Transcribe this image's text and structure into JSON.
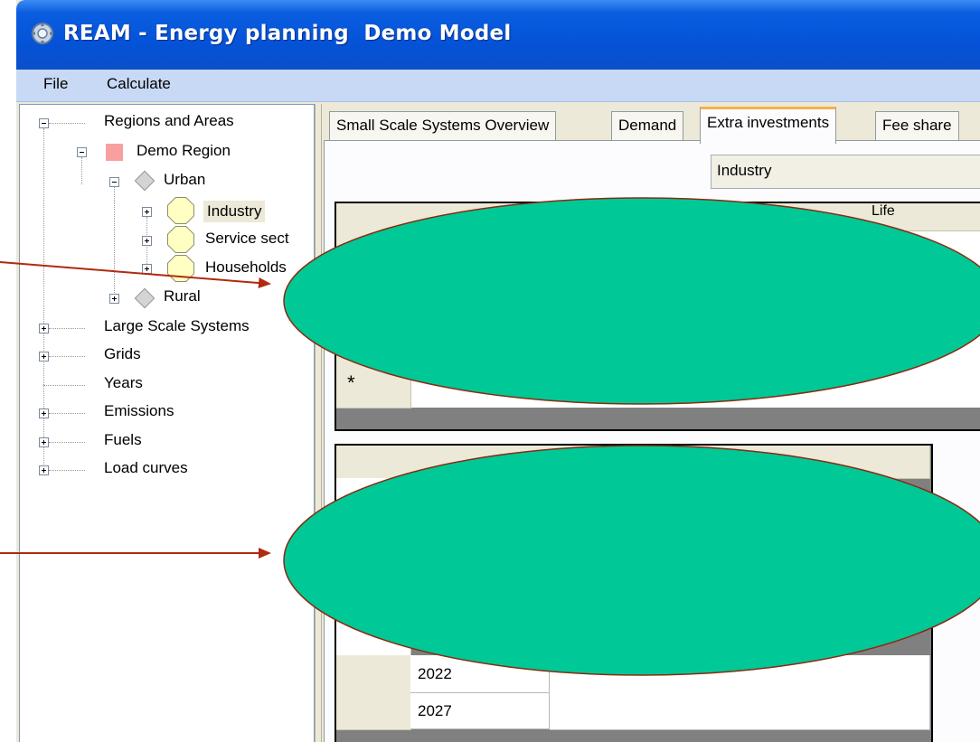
{
  "window": {
    "title": "REAM - Energy planning  Demo Model",
    "accent_color": "#0553d8"
  },
  "menu": {
    "items": [
      "File",
      "Calculate"
    ]
  },
  "tree": {
    "nodes": [
      {
        "label": "Regions and Areas",
        "icon": "none",
        "expander": "minus"
      },
      {
        "label": "Demo Region",
        "icon": "region-square",
        "expander": "minus"
      },
      {
        "label": "Urban",
        "icon": "diamond",
        "expander": "minus"
      },
      {
        "label": "Industry",
        "icon": "octagon",
        "expander": "plus",
        "selected": true
      },
      {
        "label": "Service sect",
        "icon": "octagon",
        "expander": "plus"
      },
      {
        "label": "Households",
        "icon": "octagon",
        "expander": "plus"
      },
      {
        "label": "Rural",
        "icon": "diamond",
        "expander": "plus"
      },
      {
        "label": "Large Scale Systems",
        "icon": "none",
        "expander": "plus"
      },
      {
        "label": "Grids",
        "icon": "none",
        "expander": "plus"
      },
      {
        "label": "Years",
        "icon": "none",
        "expander": "none"
      },
      {
        "label": "Emissions",
        "icon": "none",
        "expander": "plus"
      },
      {
        "label": "Fuels",
        "icon": "none",
        "expander": "plus"
      },
      {
        "label": "Load curves",
        "icon": "none",
        "expander": "plus"
      }
    ]
  },
  "tabs": [
    "Small Scale Systems Overview",
    "Demand",
    "Extra investments",
    "Fee share"
  ],
  "active_tab": "Extra investments",
  "combo": {
    "value": "Industry"
  },
  "grid1": {
    "column_headers": [
      "",
      "Life"
    ],
    "new_row_marker": "*"
  },
  "grid2": {
    "rows": [
      "2022",
      "2027"
    ]
  },
  "annotations": {
    "ellipse_color": "#00c896",
    "arrow_color": "#b02a10"
  }
}
